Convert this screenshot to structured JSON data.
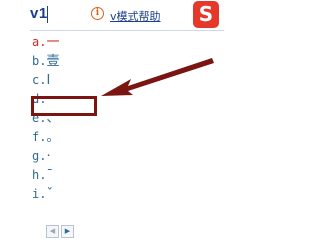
{
  "header": {
    "input_text": "v1",
    "info_icon_glyph": "i",
    "help_link": "v模式帮助",
    "logo_glyph": "S"
  },
  "candidates": [
    {
      "key": "a.",
      "value": "一"
    },
    {
      "key": "b.",
      "value": "壹"
    },
    {
      "key": "c.",
      "value": "Ⅰ"
    },
    {
      "key": "d.",
      "value": ""
    },
    {
      "key": "e.",
      "value": "、"
    },
    {
      "key": "f.",
      "value": "。"
    },
    {
      "key": "g.",
      "value": "·"
    },
    {
      "key": "h.",
      "value": "ˉ"
    },
    {
      "key": "i.",
      "value": "ˇ"
    }
  ],
  "pager": {
    "prev_glyph": "◀",
    "next_glyph": "▶"
  },
  "colors": {
    "accent_text": "#1a3f8c",
    "candidate_text": "#2f6b94",
    "first_candidate": "#d0281e",
    "annotation": "#7a1512",
    "logo": "#e4382b"
  }
}
